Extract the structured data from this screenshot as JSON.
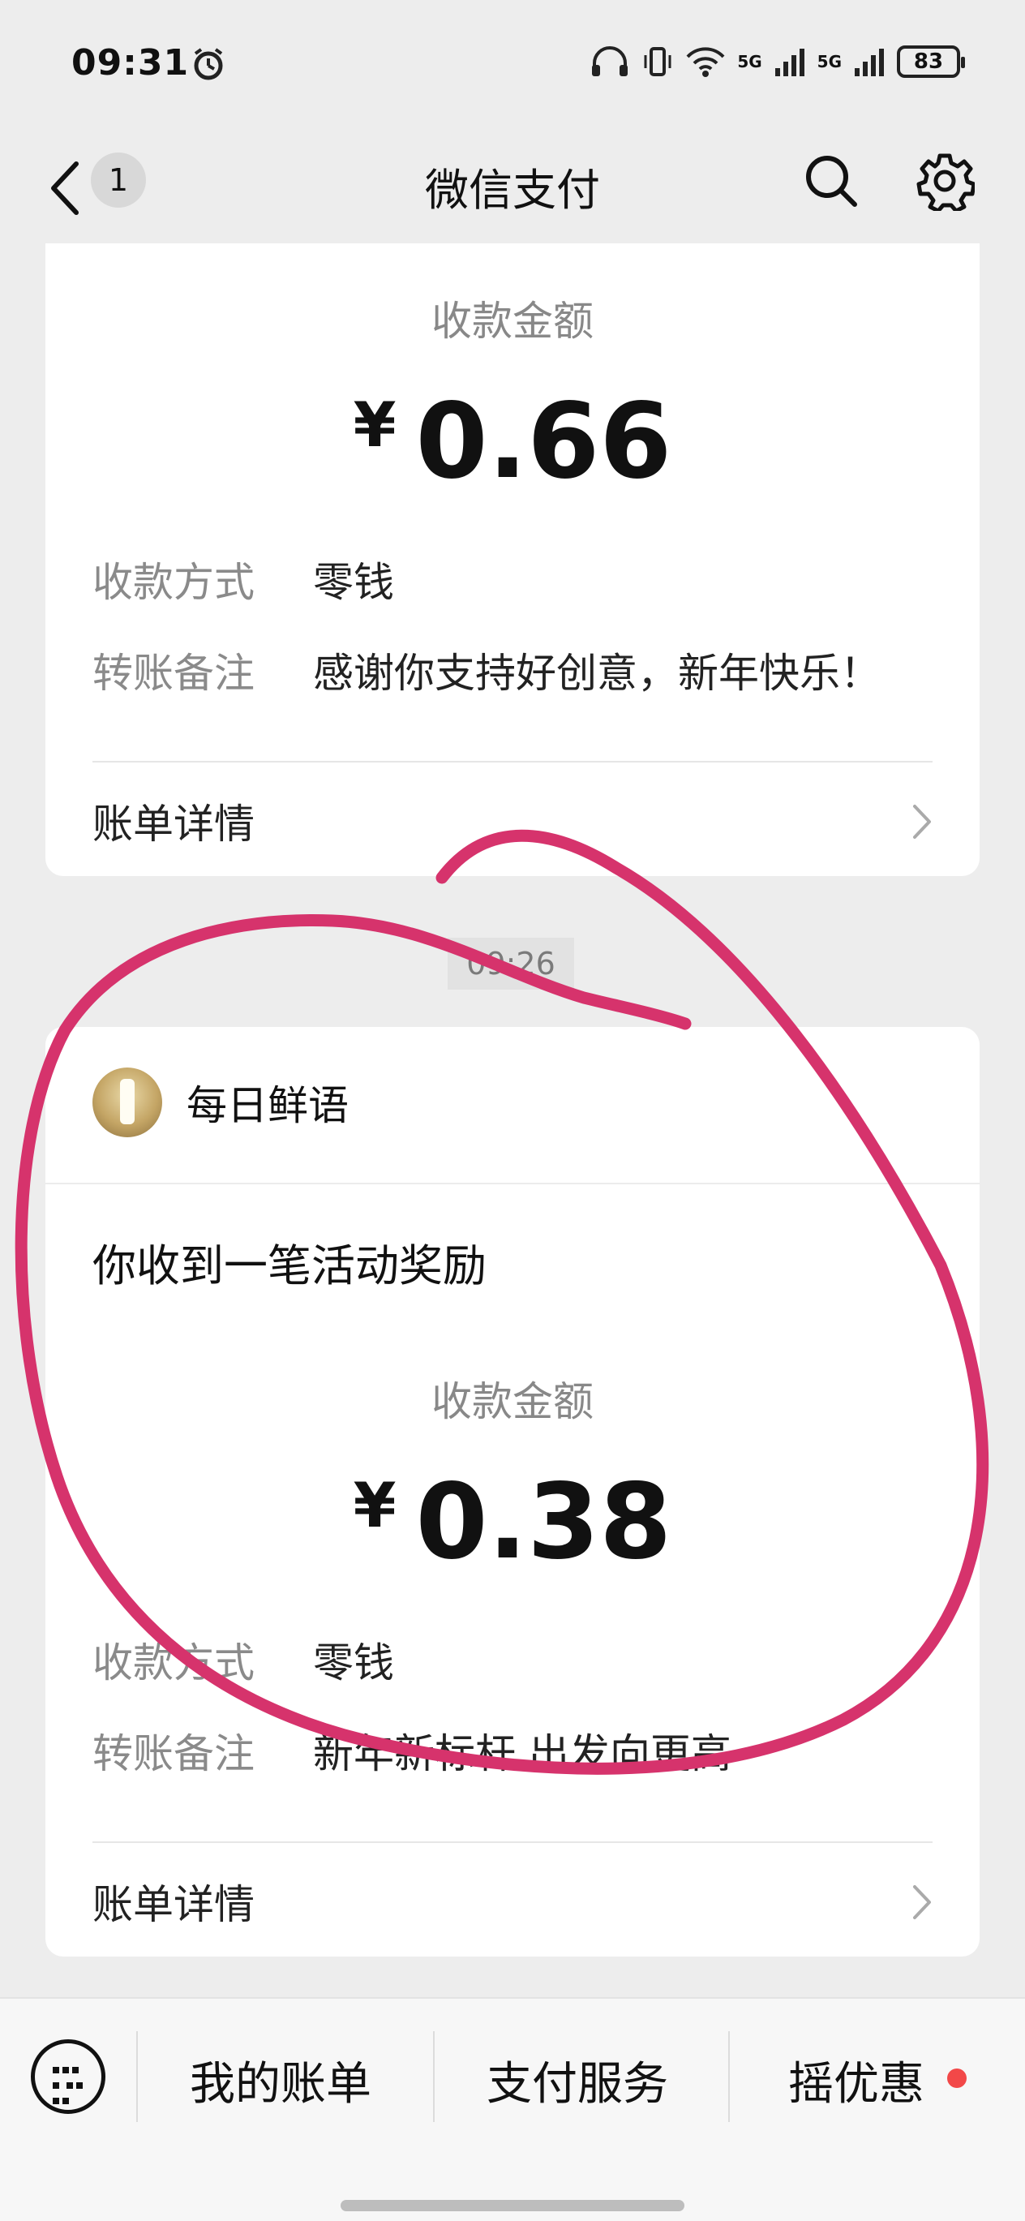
{
  "status": {
    "time": "09:31",
    "sig1": "5G",
    "sig2": "5G",
    "battery": "83"
  },
  "nav": {
    "badge": "1",
    "title": "微信支付"
  },
  "card1": {
    "amount_label": "收款金额",
    "currency": "¥",
    "amount": "0.66",
    "method_label": "收款方式",
    "method_value": "零钱",
    "note_label": "转账备注",
    "note_value": "感谢你支持好创意，新年快乐！",
    "detail_label": "账单详情"
  },
  "timestamp": "09:26",
  "card2": {
    "sender_name": "每日鲜语",
    "title": "你收到一笔活动奖励",
    "amount_label": "收款金额",
    "currency": "¥",
    "amount": "0.38",
    "method_label": "收款方式",
    "method_value": "零钱",
    "note_label": "转账备注",
    "note_value": "新年新标杆 出发向更高",
    "detail_label": "账单详情"
  },
  "bottom": {
    "tab1": "我的账单",
    "tab2": "支付服务",
    "tab3": "摇优惠"
  },
  "colors": {
    "annotation": "#d6336c",
    "notify_dot": "#f24848"
  }
}
